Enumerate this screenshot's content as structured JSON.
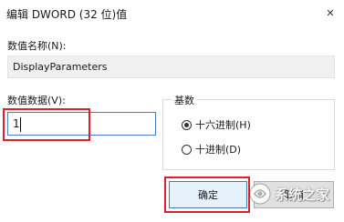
{
  "window": {
    "title": "编辑 DWORD (32 位)值",
    "close_symbol": "✕"
  },
  "value_name": {
    "label": "数值名称(N):",
    "value": "DisplayParameters"
  },
  "value_data": {
    "label": "数值数据(V):",
    "value": "1"
  },
  "base": {
    "legend": "基数",
    "options": [
      {
        "label": "十六进制(H)",
        "checked": true
      },
      {
        "label": "十进制(D)",
        "checked": false
      }
    ]
  },
  "buttons": {
    "ok_label": "确定",
    "cancel_label": "取消"
  },
  "watermark": {
    "text": "系统之家"
  },
  "colors": {
    "highlight_box": "#e0202a",
    "input_border": "#4a80c8"
  }
}
